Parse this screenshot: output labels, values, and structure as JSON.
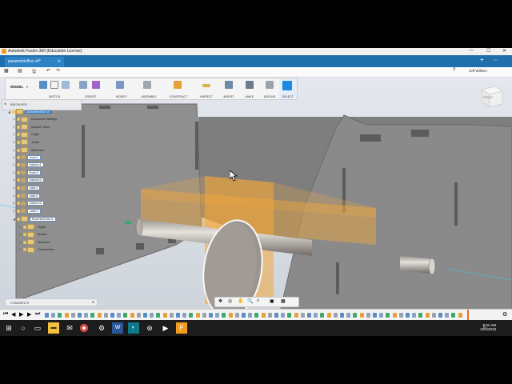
{
  "window": {
    "title": "Autodesk Fusion 360 (Education License)",
    "controls": [
      "—",
      "☐",
      "✕"
    ]
  },
  "tab": {
    "label": "parametricBox v4*",
    "close": "✕"
  },
  "quick": {
    "user": "Jeff Wilkins",
    "help": "?"
  },
  "ribbon": {
    "workspace": "MODEL",
    "groups": [
      "SKETCH",
      "CREATE",
      "MODIFY",
      "ASSEMBLE",
      "CONSTRUCT",
      "INSPECT",
      "INSERT",
      "MAKE",
      "ADD-INS",
      "SELECT"
    ]
  },
  "browser": {
    "title": "BROWSER",
    "items": [
      {
        "label": "parametricBox v4",
        "kind": "root"
      },
      {
        "label": "Document Settings",
        "kind": "folder"
      },
      {
        "label": "Named Views",
        "kind": "folder"
      },
      {
        "label": "Origin",
        "kind": "folder"
      },
      {
        "label": "Joints",
        "kind": "folder"
      },
      {
        "label": "Sketches",
        "kind": "folder"
      },
      {
        "label": "front:1",
        "kind": "body"
      },
      {
        "label": "bottom:1",
        "kind": "body"
      },
      {
        "label": "front:2",
        "kind": "body"
      },
      {
        "label": "bottom:2",
        "kind": "body"
      },
      {
        "label": "side:1",
        "kind": "body"
      },
      {
        "label": "side:2",
        "kind": "body"
      },
      {
        "label": "bottom:3",
        "kind": "body"
      },
      {
        "label": "cube:1",
        "kind": "body"
      },
      {
        "label": "EccentricCam:1",
        "kind": "component"
      },
      {
        "label": "Origin",
        "kind": "folder"
      },
      {
        "label": "Bodies",
        "kind": "folder"
      },
      {
        "label": "Sketches",
        "kind": "folder"
      },
      {
        "label": "Construction",
        "kind": "folder"
      }
    ]
  },
  "comments": {
    "label": "COMMENTS"
  },
  "viewcube": {
    "label": "FRONT"
  },
  "clock": {
    "time": "9:31 AM",
    "date": "12/5/2018"
  },
  "colors": {
    "accent": "#2e83c6",
    "plane": "#f4a83a",
    "part": "#8c8c8c"
  }
}
